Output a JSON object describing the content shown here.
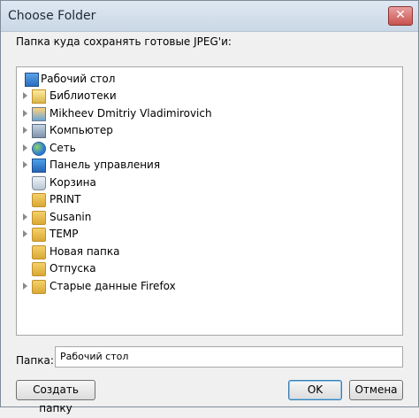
{
  "window": {
    "title": "Choose Folder",
    "close_symbol": "✕"
  },
  "prompt": "Папка куда сохранять готовые JPEG'и:",
  "tree": {
    "items": [
      {
        "label": "Рабочий стол",
        "icon": "desktop-icon",
        "expandable": false
      },
      {
        "label": "Библиотеки",
        "icon": "libraries-folder-icon",
        "expandable": true
      },
      {
        "label": "Mikheev Dmitriy Vladimirovich",
        "icon": "user-icon",
        "expandable": true
      },
      {
        "label": "Компьютер",
        "icon": "computer-icon",
        "expandable": true
      },
      {
        "label": "Сеть",
        "icon": "network-icon",
        "expandable": true
      },
      {
        "label": "Панель управления",
        "icon": "control-panel-icon",
        "expandable": true
      },
      {
        "label": "Корзина",
        "icon": "recycle-bin-icon",
        "expandable": false
      },
      {
        "label": "PRINT",
        "icon": "folder-icon",
        "expandable": false
      },
      {
        "label": "Susanin",
        "icon": "folder-icon",
        "expandable": true
      },
      {
        "label": "TEMP",
        "icon": "folder-icon",
        "expandable": true
      },
      {
        "label": "Новая папка",
        "icon": "folder-icon",
        "expandable": false
      },
      {
        "label": "Отпуска",
        "icon": "folder-icon",
        "expandable": false
      },
      {
        "label": "Старые данные Firefox",
        "icon": "folder-icon",
        "expandable": true
      }
    ]
  },
  "folder_field": {
    "label": "Папка:",
    "value": "Рабочий стол"
  },
  "buttons": {
    "new_folder": "Создать папку",
    "ok": "OK",
    "cancel": "Отмена"
  }
}
